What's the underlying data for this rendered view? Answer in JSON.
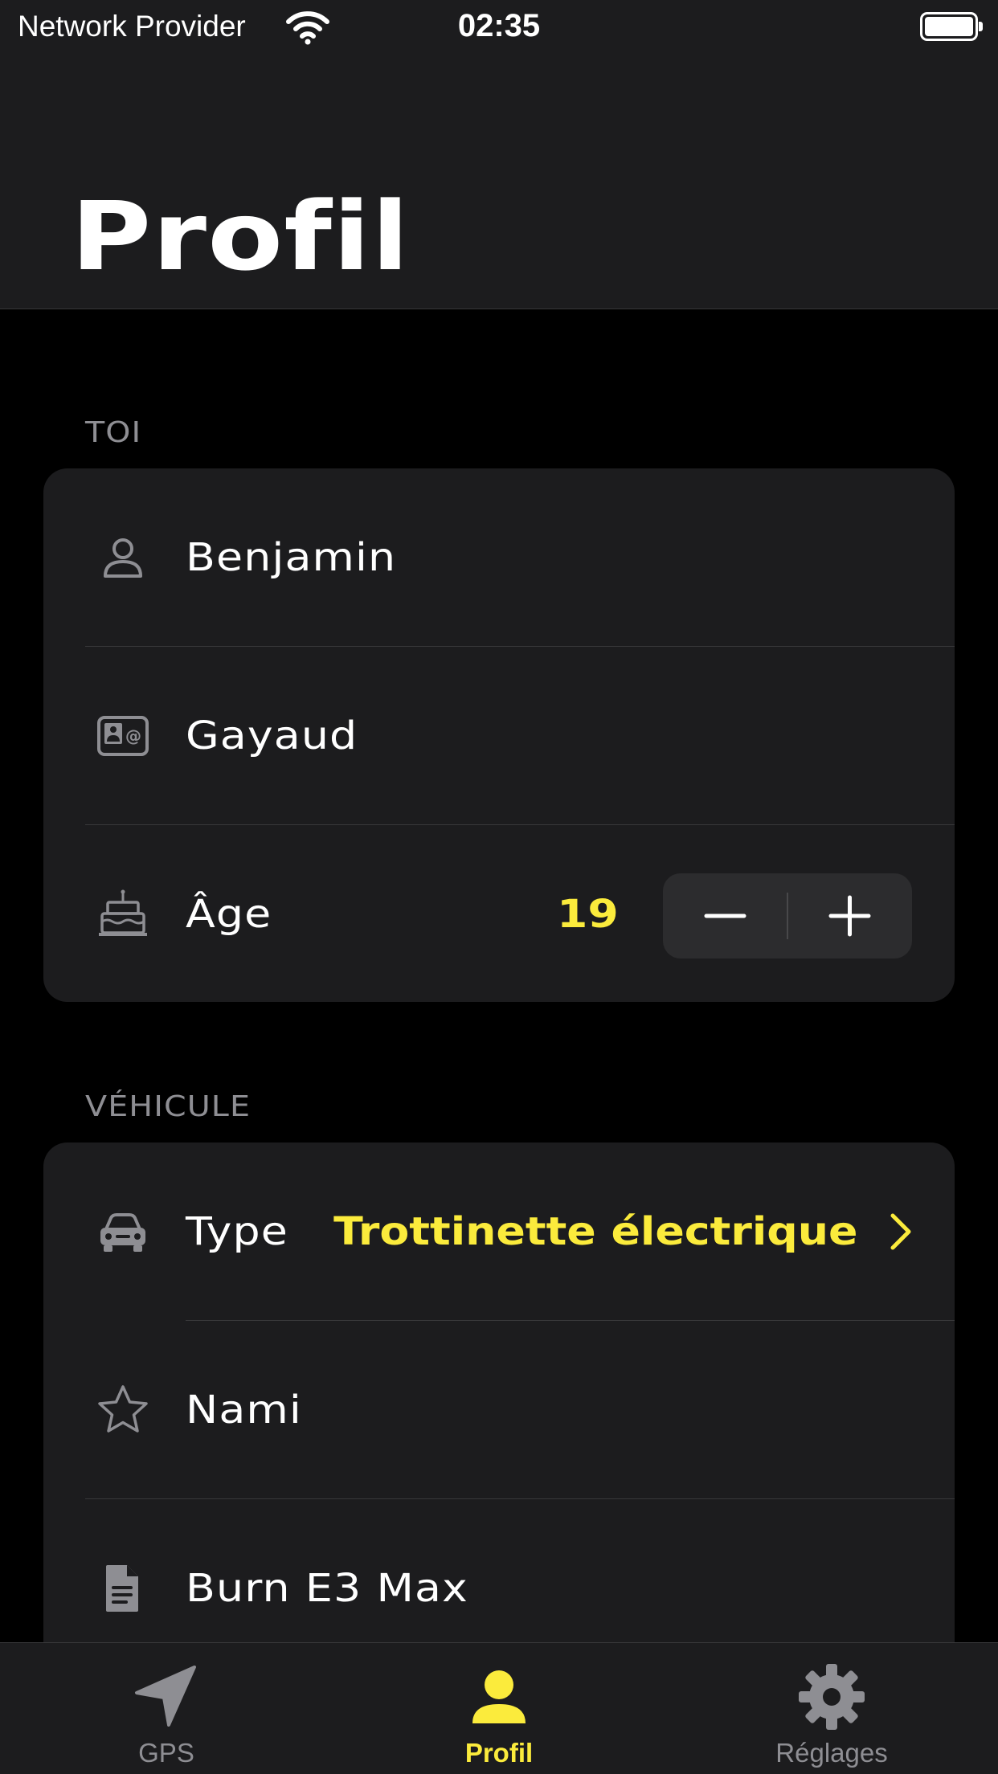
{
  "status_bar": {
    "carrier": "Network Provider",
    "time": "02:35"
  },
  "header": {
    "title": "Profil"
  },
  "sections": {
    "you": {
      "header": "TOI",
      "first_name": "Benjamin",
      "last_name": "Gayaud",
      "age_label": "Âge",
      "age_value": "19"
    },
    "vehicle": {
      "header": "VÉHICULE",
      "type_label": "Type",
      "type_value": "Trottinette électrique",
      "name": "Nami",
      "model": "Burn E3 Max"
    }
  },
  "tabbar": {
    "tabs": [
      {
        "label": "GPS",
        "icon": "location-arrow-icon",
        "active": false
      },
      {
        "label": "Profil",
        "icon": "person-icon",
        "active": true
      },
      {
        "label": "Réglages",
        "icon": "gear-icon",
        "active": false
      }
    ]
  },
  "colors": {
    "accent": "#fbeb3c",
    "background": "#000000",
    "card": "#1c1c1e",
    "secondary_text": "#8e8e93"
  }
}
